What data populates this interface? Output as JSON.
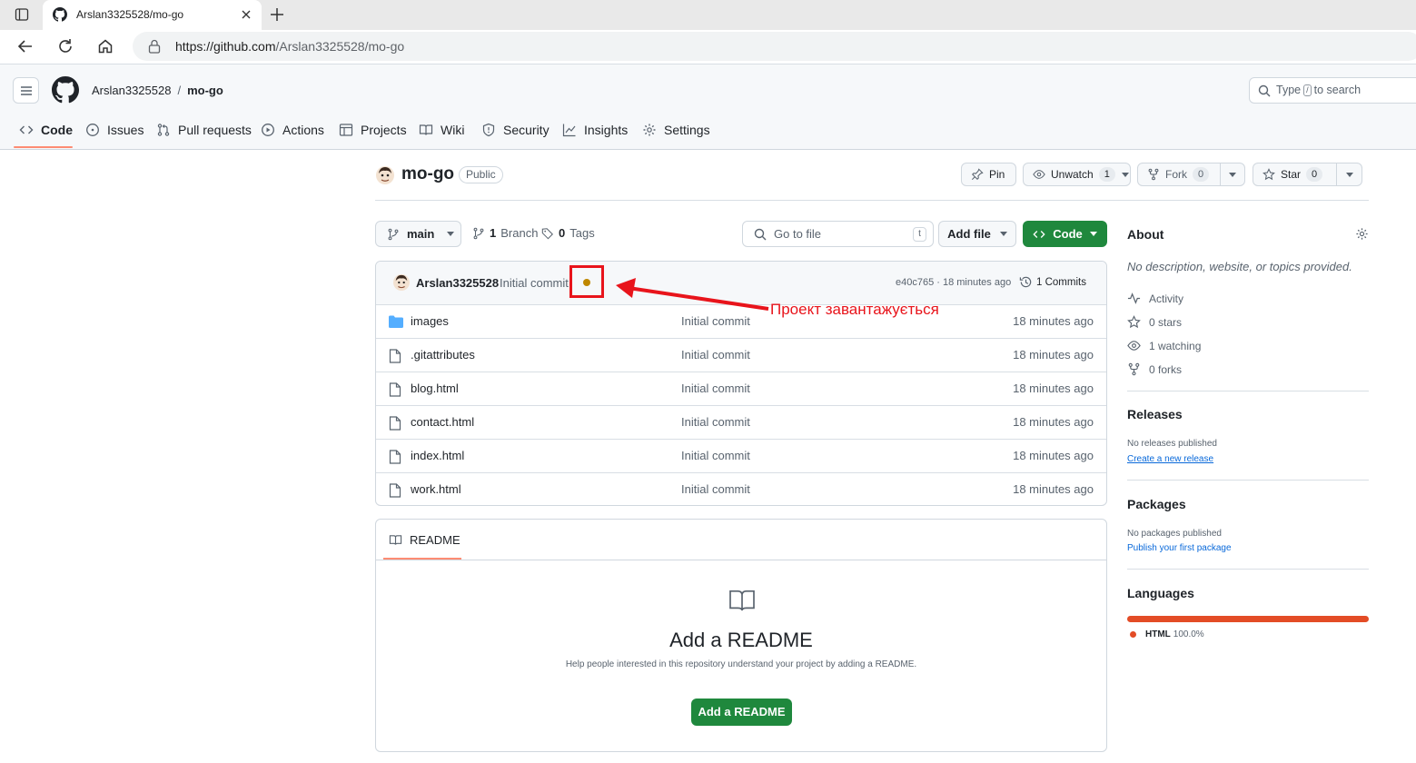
{
  "browser": {
    "tab_title": "Arslan3325528/mo-go",
    "url_host": "https://github.com",
    "url_path": "/Arslan3325528/mo-go"
  },
  "header": {
    "owner": "Arslan3325528",
    "separator": "/",
    "repo": "mo-go",
    "search_prefix": "Type",
    "search_key": "/",
    "search_suffix": "to search"
  },
  "nav": {
    "tabs": [
      "Code",
      "Issues",
      "Pull requests",
      "Actions",
      "Projects",
      "Wiki",
      "Security",
      "Insights",
      "Settings"
    ]
  },
  "repo": {
    "name": "mo-go",
    "visibility": "Public",
    "pin_label": "Pin",
    "unwatch_label": "Unwatch",
    "watch_count": "1",
    "fork_label": "Fork",
    "fork_count": "0",
    "star_label": "Star",
    "star_count": "0"
  },
  "files_toolbar": {
    "branch": "main",
    "branch_count": "1",
    "branch_label": "Branch",
    "tag_count": "0",
    "tag_label": "Tags",
    "goto_placeholder": "Go to file",
    "goto_kbd": "t",
    "add_file_label": "Add file",
    "code_label": "Code"
  },
  "commit": {
    "author": "Arslan3325528",
    "message": "Initial commit",
    "sha_time": "e40c765 · 18 minutes ago",
    "commits_label": "1 Commits",
    "status_color": "#bf8700"
  },
  "files": [
    {
      "name": "images",
      "type": "folder",
      "message": "Initial commit",
      "age": "18 minutes ago"
    },
    {
      "name": ".gitattributes",
      "type": "file",
      "message": "Initial commit",
      "age": "18 minutes ago"
    },
    {
      "name": "blog.html",
      "type": "file",
      "message": "Initial commit",
      "age": "18 minutes ago"
    },
    {
      "name": "contact.html",
      "type": "file",
      "message": "Initial commit",
      "age": "18 minutes ago"
    },
    {
      "name": "index.html",
      "type": "file",
      "message": "Initial commit",
      "age": "18 minutes ago"
    },
    {
      "name": "work.html",
      "type": "file",
      "message": "Initial commit",
      "age": "18 minutes ago"
    }
  ],
  "annotation": {
    "text": "Проект завантажується",
    "color": "#e8141b"
  },
  "readme": {
    "tab_label": "README",
    "title": "Add a README",
    "description": "Help people interested in this repository understand your project by adding a README.",
    "button_label": "Add a README"
  },
  "about": {
    "heading": "About",
    "description": "No description, website, or topics provided.",
    "activity": "Activity",
    "stars": "0 stars",
    "watching": "1 watching",
    "forks": "0 forks"
  },
  "releases": {
    "heading": "Releases",
    "empty": "No releases published",
    "link": "Create a new release"
  },
  "packages": {
    "heading": "Packages",
    "empty": "No packages published",
    "link": "Publish your first package"
  },
  "languages": {
    "heading": "Languages",
    "name": "HTML",
    "percent_label": "100.0%",
    "percent_value": 100,
    "color": "#e34c26"
  }
}
